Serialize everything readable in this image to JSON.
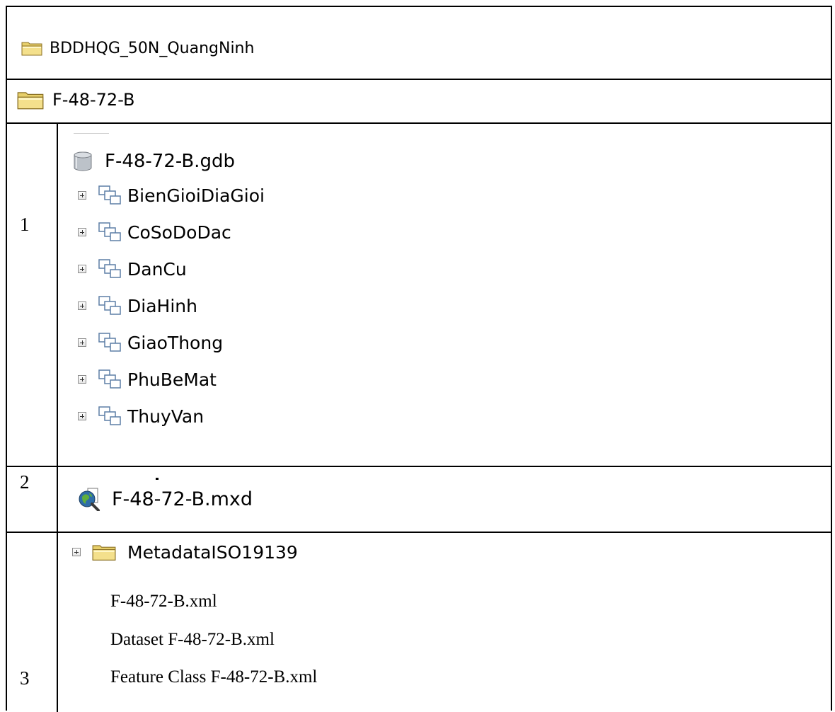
{
  "header": {
    "root_folder": "BDDHQG_50N_QuangNinh",
    "sheet_folder": "F-48-72-B"
  },
  "rows": {
    "r1_num": "1",
    "r2_num": "2",
    "r3_num": "3"
  },
  "gdb": {
    "name": "F-48-72-B.gdb",
    "datasets": [
      "BienGioiDiaGioi",
      "CoSoDoDac",
      "DanCu",
      "DiaHinh",
      "GiaoThong",
      "PhuBeMat",
      "ThuyVan"
    ]
  },
  "mxd": {
    "name": "F-48-72-B.mxd"
  },
  "metadata": {
    "folder": "MetadataISO19139",
    "files": [
      "F-48-72-B.xml",
      "Dataset F-48-72-B.xml",
      "Feature Class F-48-72-B.xml"
    ]
  },
  "icons": {
    "folder": "folder-icon",
    "database": "geodatabase-icon",
    "feature_dataset": "feature-dataset-icon",
    "map_document": "map-document-icon",
    "expand": "expand-plus-icon"
  }
}
